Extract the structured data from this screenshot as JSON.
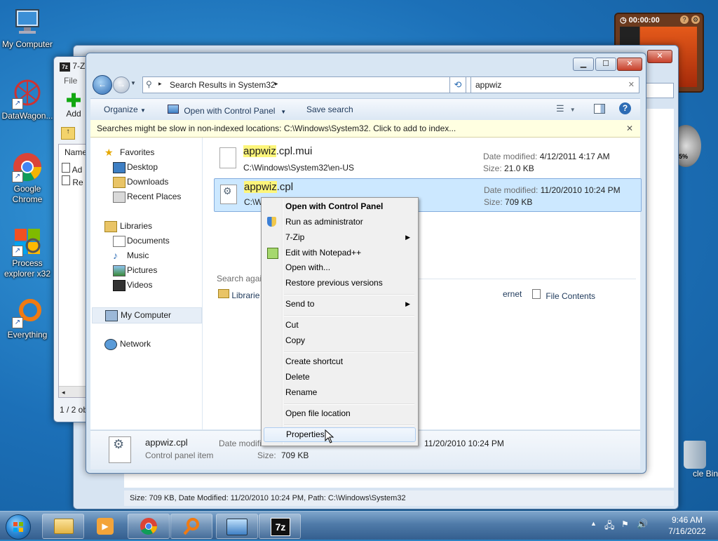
{
  "desktop": {
    "icons": [
      {
        "label": "My Computer"
      },
      {
        "label": "DataWagon..."
      },
      {
        "label": "Google Chrome"
      },
      {
        "label": "Process explorer x32"
      },
      {
        "label": "Everything"
      }
    ],
    "right_icons": {
      "recycle_label": "cle Bin"
    }
  },
  "clock_gadget": {
    "time": "00:00:00"
  },
  "gauge_gadget": {
    "text": "5%"
  },
  "sevenzip_window": {
    "title_abbrev": "7-Z",
    "menu_file": "File",
    "add_label": "Add",
    "col_name": "Name",
    "rows": [
      "Ad",
      "Re"
    ],
    "status": "1 / 2 ob"
  },
  "back_window": {
    "status_text": "Size: 709 KB, Date Modified: 11/20/2010 10:24 PM, Path: C:\\Windows\\System32"
  },
  "explorer": {
    "breadcrumb": "Search Results in System32",
    "search_value": "appwiz",
    "toolbar": {
      "organize": "Organize",
      "open_with": "Open with Control Panel",
      "save_search": "Save search"
    },
    "infobar": "Searches might be slow in non-indexed locations: C:\\Windows\\System32. Click to add to index...",
    "nav": {
      "favorites": "Favorites",
      "desktop": "Desktop",
      "downloads": "Downloads",
      "recent": "Recent Places",
      "libraries": "Libraries",
      "documents": "Documents",
      "music": "Music",
      "pictures": "Pictures",
      "videos": "Videos",
      "my_computer": "My Computer",
      "network": "Network"
    },
    "results": [
      {
        "name_hl": "appwiz",
        "name_rest": ".cpl.mui",
        "path": "C:\\Windows\\System32\\en-US",
        "date_label": "Date modified:",
        "date": "4/12/2011 4:17 AM",
        "size_label": "Size:",
        "size": "21.0 KB"
      },
      {
        "name_hl": "appwiz",
        "name_rest": ".cpl",
        "path": "C:\\W",
        "date_label": "Date modified:",
        "date": "11/20/2010 10:24 PM",
        "size_label": "Size:",
        "size": "709 KB"
      }
    ],
    "search_again": {
      "label": "Search agai",
      "libraries": "Librarie",
      "internet": "ernet",
      "file_contents": "File Contents"
    },
    "details": {
      "name": "appwiz.cpl",
      "type": "Control panel item",
      "date_label": "Date modifi",
      "date": "11/20/2010 10:24 PM",
      "size_label": "Size:",
      "size": "709 KB"
    }
  },
  "context_menu": {
    "items": [
      "Open with Control Panel",
      "Run as administrator",
      "7-Zip",
      "Edit with Notepad++",
      "Open with...",
      "Restore previous versions",
      "Send to",
      "Cut",
      "Copy",
      "Create shortcut",
      "Delete",
      "Rename",
      "Open file location",
      "Properties"
    ]
  },
  "taskbar": {
    "time": "9:46 AM",
    "date": "7/16/2022",
    "zip_label": "7z"
  },
  "colors": {
    "accent": "#1e395b",
    "highlight": "#fdf57a",
    "selection": "#cce8ff"
  }
}
